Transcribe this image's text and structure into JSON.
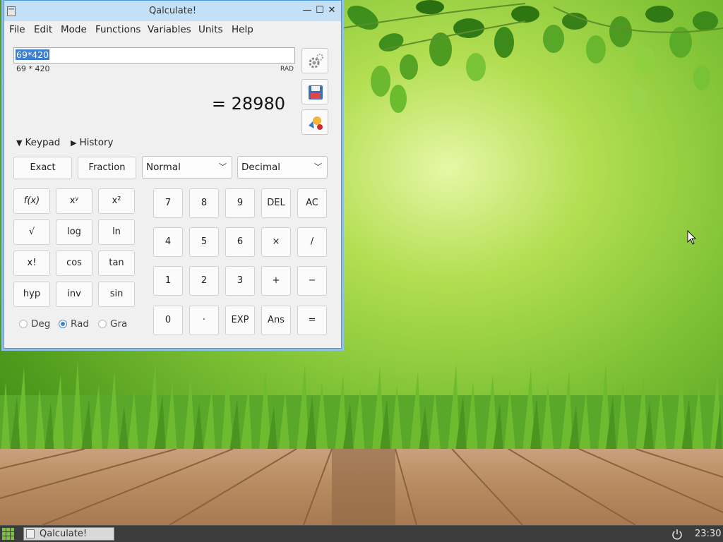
{
  "window": {
    "title": "Qalculate!",
    "controls": {
      "minimize": "—",
      "maximize": "☐",
      "close": "✕"
    }
  },
  "menu": [
    "File",
    "Edit",
    "Mode",
    "Functions",
    "Variables",
    "Units",
    "Help"
  ],
  "expression": {
    "value": "69*420",
    "parsed": "69 * 420",
    "angle_unit": "RAD"
  },
  "result": "= 28980",
  "side_buttons": [
    "gear-icon",
    "save-icon",
    "convert-units-icon"
  ],
  "toggles": {
    "keypad": "Keypad",
    "history": "History"
  },
  "mode_buttons": {
    "exact": "Exact",
    "fraction": "Fraction"
  },
  "combos": {
    "number_format": "Normal",
    "base": "Decimal"
  },
  "function_keys": [
    [
      "f(x)",
      "xʸ",
      "x²"
    ],
    [
      "√",
      "log",
      "ln"
    ],
    [
      "x!",
      "cos",
      "tan"
    ],
    [
      "hyp",
      "inv",
      "sin"
    ]
  ],
  "number_keys": [
    [
      "7",
      "8",
      "9",
      "DEL",
      "AC"
    ],
    [
      "4",
      "5",
      "6",
      "×",
      "/"
    ],
    [
      "1",
      "2",
      "3",
      "+",
      "−"
    ],
    [
      "0",
      "·",
      "EXP",
      "Ans",
      "="
    ]
  ],
  "angle_options": [
    {
      "label": "Deg",
      "selected": false
    },
    {
      "label": "Rad",
      "selected": true
    },
    {
      "label": "Gra",
      "selected": false
    }
  ],
  "taskbar": {
    "task_label": "Qalculate!",
    "clock": "23:30"
  },
  "colors": {
    "titlebar": "#c4e0f6",
    "window_border": "#4a96d3",
    "selection": "#3d7fcf",
    "taskbar": "#3c3c3c"
  }
}
